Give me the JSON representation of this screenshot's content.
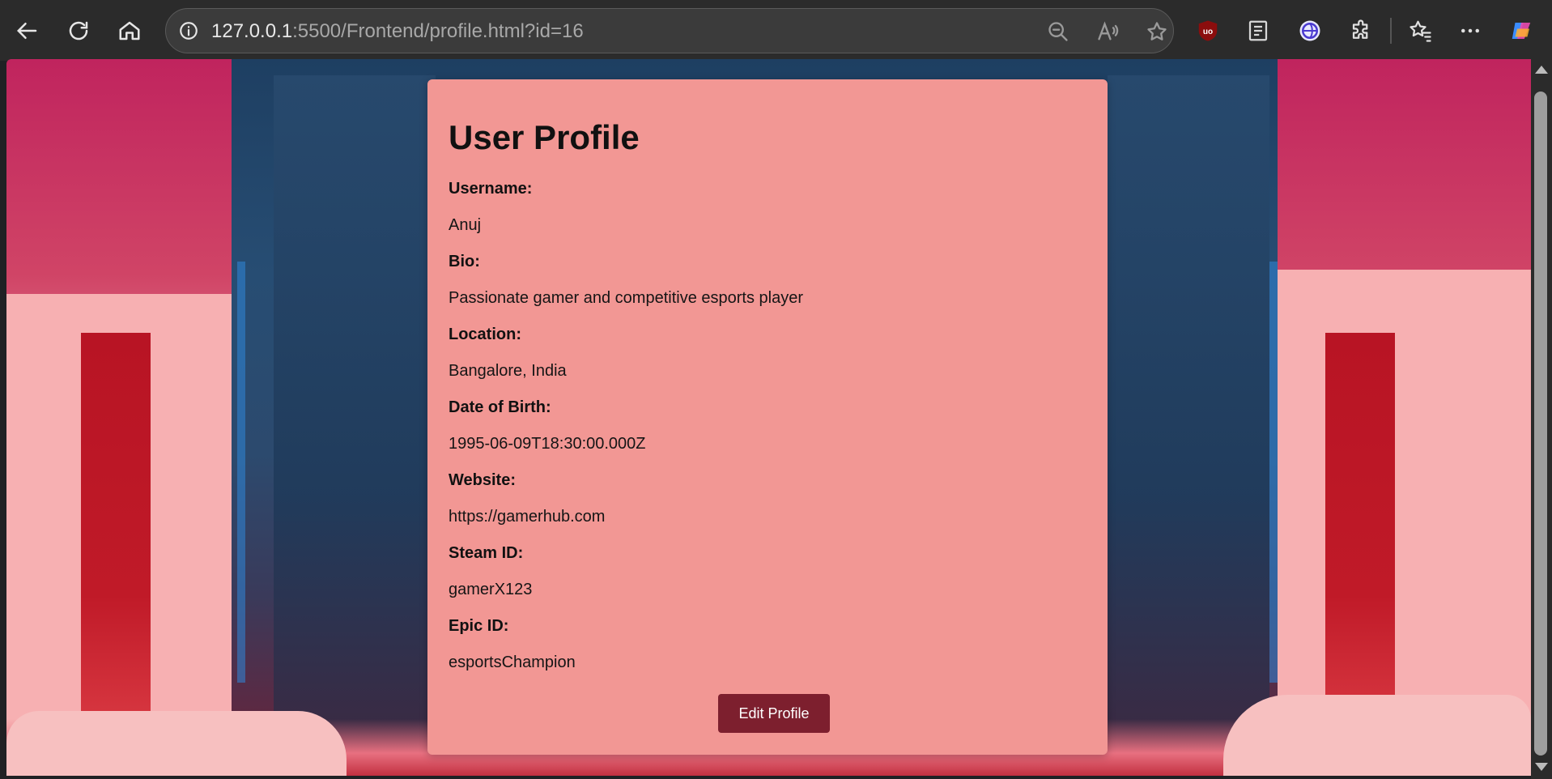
{
  "browser": {
    "url_host": "127.0.0.1",
    "url_rest": ":5500/Frontend/profile.html?id=16"
  },
  "profile": {
    "title": "User Profile",
    "fields": [
      {
        "label": "Username:",
        "value": "Anuj"
      },
      {
        "label": "Bio:",
        "value": "Passionate gamer and competitive esports player"
      },
      {
        "label": "Location:",
        "value": "Bangalore, India"
      },
      {
        "label": "Date of Birth:",
        "value": "1995-06-09T18:30:00.000Z"
      },
      {
        "label": "Website:",
        "value": "https://gamerhub.com"
      },
      {
        "label": "Steam ID:",
        "value": "gamerX123"
      },
      {
        "label": "Epic ID:",
        "value": "esportsChampion"
      }
    ],
    "edit_button_label": "Edit Profile"
  },
  "colors": {
    "card_bg": "#f29794",
    "button_bg": "#7d1f2e"
  }
}
